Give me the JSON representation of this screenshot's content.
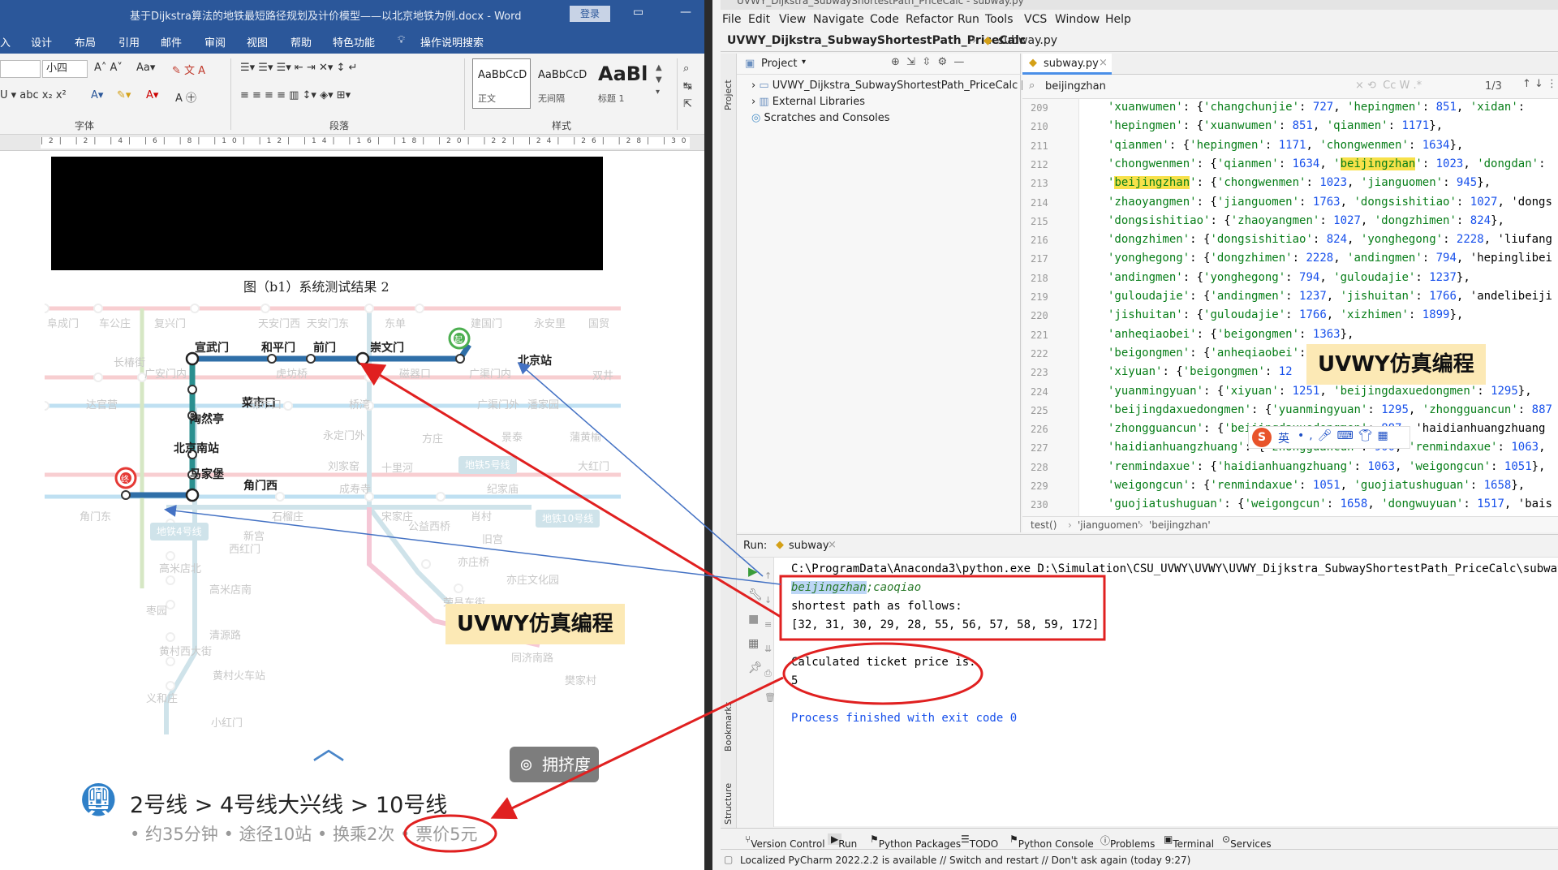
{
  "word": {
    "title": "基于Dijkstra算法的地铁最短路径规划及计价模型——以北京地铁为例.docx  -  Word",
    "login": "登录",
    "tabs": [
      "入",
      "设计",
      "布局",
      "引用",
      "邮件",
      "审阅",
      "视图",
      "帮助",
      "特色功能",
      "操作说明搜索"
    ],
    "font_size": "小四",
    "groups": {
      "font": "字体",
      "paragraph": "段落",
      "styles": "样式"
    },
    "styles": [
      {
        "preview": "AaBbCcD",
        "name": "正文"
      },
      {
        "preview": "AaBbCcD",
        "name": "无间隔"
      },
      {
        "preview": "AaBl",
        "name": "标题 1"
      }
    ],
    "ruler": "|2|  |2|  |4|  |6|  |8|  |10|  |12|  |14|  |16|  |18|  |20|  |22|  |24|  |26|  |28|  |30|  |32|  |34|  |36|  |38|  |40|  |42|  |44|",
    "caption": "图（b1）系统测试结果 2",
    "map": {
      "highlighted_stations": [
        "宣武门",
        "和平门",
        "前门",
        "崇文门",
        "北京站",
        "菜市口",
        "陶然亭",
        "北京南站",
        "马家堡",
        "角门西"
      ],
      "faded_stations": [
        "阜成门",
        "车公庄",
        "复兴门",
        "天安门西",
        "天安门东",
        "东单",
        "建国门",
        "永安里",
        "国贸",
        "长椿街",
        "广安门内",
        "虎坊桥",
        "磁器口",
        "广渠门内",
        "双井",
        "达官营",
        "珠市口",
        "桥湾",
        "广渠门外",
        "潘家园",
        "永定门外",
        "方庄",
        "景泰",
        "蒲黄榆",
        "刘家窑",
        "十里河",
        "大红门",
        "成寿寺",
        "纪家庙",
        "角门东",
        "石榴庄",
        "宋家庄",
        "肖村",
        "公益西桥",
        "新宫",
        "西红门",
        "高米店北",
        "高米店南",
        "枣园",
        "清源路",
        "黄村西大街",
        "黄村火车站",
        "义和庄",
        "小红门",
        "旧宫",
        "亦庄桥",
        "亦庄文化园",
        "荣昌东街",
        "同济南路",
        "樊家村"
      ],
      "line_tags": [
        "地铁5号线",
        "地铁4号线",
        "地铁10号线"
      ],
      "start_badge": "起",
      "end_badge": "终"
    },
    "crowd_button": "拥挤度",
    "route": "2号线 > 4号线大兴线 > 10号线",
    "route_info": "• 约35分钟 • 途径10站 • 换乘2次 • ",
    "fare": "票价5元",
    "banner": "UVWY仿真编程"
  },
  "ide": {
    "title": "UVWY_Dijkstra_SubwayShortestPath_PriceCalc - subway.py",
    "menu": [
      "File",
      "Edit",
      "View",
      "Navigate",
      "Code",
      "Refactor",
      "Run",
      "Tools",
      "VCS",
      "Window",
      "Help"
    ],
    "nav_project": "UVWY_Dijkstra_SubwayShortestPath_PriceCalc",
    "nav_file": "subway.py",
    "project_label": "Project",
    "tree": [
      "UVWY_Dijkstra_SubwayShortestPath_PriceCalc [D",
      "External Libraries",
      "Scratches and Consoles"
    ],
    "editor_tab": "subway.py",
    "find_query": "beijingzhan",
    "find_count": "1/3",
    "code_lines": [
      {
        "ln": "209",
        "text": "'xuanwumen': {'changchunjie': 727, 'hepingmen': 851, 'xidan':"
      },
      {
        "ln": "210",
        "text": "'hepingmen': {'xuanwumen': 851, 'qianmen': 1171},"
      },
      {
        "ln": "211",
        "text": "'qianmen': {'hepingmen': 1171, 'chongwenmen': 1634},"
      },
      {
        "ln": "212",
        "text": "'chongwenmen': {'qianmen': 1634, 'beijingzhan': 1023, 'dongdan':"
      },
      {
        "ln": "213",
        "text": "'beijingzhan': {'chongwenmen': 1023, 'jianguomen': 945},"
      },
      {
        "ln": "214",
        "text": "'zhaoyangmen': {'jianguomen': 1763, 'dongsishitiao': 1027, 'dongs"
      },
      {
        "ln": "215",
        "text": "'dongsishitiao': {'zhaoyangmen': 1027, 'dongzhimen': 824},"
      },
      {
        "ln": "216",
        "text": "'dongzhimen': {'dongsishitiao': 824, 'yonghegong': 2228, 'liufang"
      },
      {
        "ln": "217",
        "text": "'yonghegong': {'dongzhimen': 2228, 'andingmen': 794, 'hepinglibei"
      },
      {
        "ln": "218",
        "text": "'andingmen': {'yonghegong': 794, 'guloudajie': 1237},"
      },
      {
        "ln": "219",
        "text": "'guloudajie': {'andingmen': 1237, 'jishuitan': 1766, 'andelibeiji"
      },
      {
        "ln": "220",
        "text": "'jishuitan': {'guloudajie': 1766, 'xizhimen': 1899},"
      },
      {
        "ln": "221",
        "text": "'anheqiaobei': {'beigongmen': 1363},"
      },
      {
        "ln": "222",
        "text": "'beigongmen': {'anheqiaobei': 1363, 'xiyuan': 1251},"
      },
      {
        "ln": "223",
        "text": "'xiyuan': {'beigongmen': 12"
      },
      {
        "ln": "224",
        "text": "'yuanmingyuan': {'xiyuan': 1251, 'beijingdaxuedongmen': 1295},"
      },
      {
        "ln": "225",
        "text": "'beijingdaxuedongmen': {'yuanmingyuan': 1295, 'zhongguancun': 887"
      },
      {
        "ln": "226",
        "text": "'zhongguancun': {'beijingdaxuedongmen': 887, 'haidianhuangzhuang"
      },
      {
        "ln": "227",
        "text": "'haidianhuangzhuang': {'zhongguancun': 900, 'renmindaxue': 1063,"
      },
      {
        "ln": "228",
        "text": "'renmindaxue': {'haidianhuangzhuang': 1063, 'weigongcun': 1051},"
      },
      {
        "ln": "229",
        "text": "'weigongcun': {'renmindaxue': 1051, 'guojiatushuguan': 1658},"
      },
      {
        "ln": "230",
        "text": "'guojiatushuguan': {'weigongcun': 1658, 'dongwuyuan': 1517, 'bais"
      },
      {
        "ln": "231",
        "text": "'dongwuyuan': {'guojiatushuguan': 1517, 'xizhimen': 1441},"
      }
    ],
    "breadcrumb": [
      "test()",
      "'jianguomen'",
      "'beijingzhan'"
    ],
    "run_label": "Run:",
    "run_tab": "subway",
    "output": [
      "C:\\ProgramData\\Anaconda3\\python.exe D:\\Simulation\\CSU_UVWY\\UVWY\\UVWY_Dijkstra_SubwayShortestPath_PriceCalc\\subway.",
      "beijingzhan;caoqiao",
      "shortest path as follows:",
      "[32, 31, 30, 29, 28, 55, 56, 57, 58, 59, 172]",
      "",
      "Calculated ticket price is:",
      "5",
      "",
      "Process finished with exit code 0"
    ],
    "bottom_tabs": [
      "Version Control",
      "Run",
      "Python Packages",
      "TODO",
      "Python Console",
      "Problems",
      "Terminal",
      "Services"
    ],
    "info": "Localized PyCharm 2022.2.2 is available // Switch and restart // Don't ask again (today 9:27)",
    "side_labels": [
      "Project",
      "Bookmarks",
      "Structure"
    ],
    "ime": "英",
    "banner": "UVWY仿真编程"
  },
  "colors": {
    "word_blue": "#2b579a",
    "annotation_red": "#e02020",
    "annotation_blue": "#4472c4",
    "banner_bg": "#fce9b5",
    "line2": "#2f6fa8",
    "line4": "#2a8f8f"
  }
}
